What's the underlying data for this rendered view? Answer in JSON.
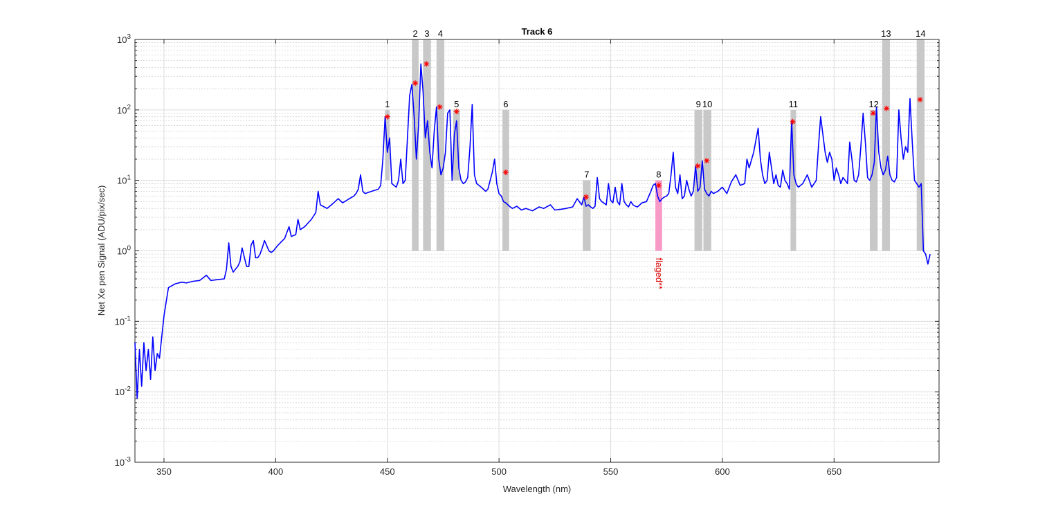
{
  "chart_data": {
    "type": "line",
    "title": "Track 6",
    "xlabel": "Wavelength (nm)",
    "ylabel": "Net Xe pen Signal (ADU/pix/sec)",
    "xlim": [
      337,
      697
    ],
    "ylim": [
      0.001,
      1000
    ],
    "yscale": "log",
    "grid": true,
    "x_ticks": [
      350,
      400,
      450,
      500,
      550,
      600,
      650
    ],
    "y_tick_exponents": [
      -3,
      -2,
      -1,
      0,
      1,
      2,
      3
    ],
    "y_tick_base": "10",
    "colors": {
      "line": "#0000ff",
      "marker": "#ff0000",
      "band": "#c8c8c8",
      "flag_band": "#f79ac8",
      "flag_text": "#dd0000"
    },
    "series": [
      {
        "values_x": [
          337,
          338,
          339,
          340,
          341,
          342,
          343,
          344,
          345,
          346,
          347,
          348,
          349,
          350,
          352,
          355,
          358,
          360,
          363,
          366,
          369,
          371,
          374,
          377,
          378,
          379,
          380,
          381,
          382,
          383,
          384,
          385,
          386,
          387,
          388,
          389,
          390,
          391,
          392,
          393,
          394,
          395,
          397,
          398,
          399,
          401,
          404,
          406,
          407,
          409,
          410,
          411,
          413,
          416,
          418,
          419,
          420,
          423,
          426,
          428,
          430,
          433,
          435,
          436,
          437,
          438,
          439,
          440,
          443,
          446,
          447,
          448,
          449,
          450,
          451,
          452,
          453,
          454,
          455,
          456,
          457,
          458,
          459,
          460,
          461,
          462,
          463,
          464,
          465,
          466,
          467,
          468,
          469,
          470,
          471,
          472,
          473,
          474,
          475,
          476,
          477,
          478,
          479,
          480,
          481,
          482,
          483,
          484,
          485,
          486,
          487,
          488,
          489,
          490,
          491,
          492,
          493,
          494,
          495,
          497,
          498,
          499,
          500,
          501,
          502,
          503,
          504,
          505,
          506,
          508,
          510,
          512,
          515,
          518,
          520,
          523,
          525,
          528,
          530,
          533,
          535,
          537,
          538,
          539,
          540,
          541,
          542,
          543,
          544,
          545,
          546,
          548,
          549,
          550,
          551,
          552,
          553,
          554,
          555,
          556,
          557,
          558,
          559,
          560,
          561,
          562,
          564,
          566,
          568,
          569,
          570,
          571,
          572,
          573,
          574,
          575,
          576,
          577,
          578,
          579,
          580,
          581,
          582,
          583,
          584,
          585,
          586,
          587,
          588,
          589,
          590,
          591,
          592,
          593,
          594,
          595,
          596,
          598,
          600,
          602,
          604,
          606,
          608,
          610,
          611,
          612,
          614,
          616,
          617,
          618,
          619,
          620,
          621,
          622,
          623,
          624,
          625,
          626,
          627,
          628,
          629,
          630,
          631,
          632,
          633,
          634,
          636,
          638,
          640,
          642,
          643,
          644,
          646,
          647,
          648,
          649,
          650,
          651,
          652,
          653,
          654,
          655,
          656,
          657,
          658,
          659,
          660,
          661,
          662,
          663,
          664,
          665,
          666,
          667,
          668,
          669,
          670,
          671,
          672,
          673,
          674,
          675,
          676,
          677,
          678,
          679,
          680,
          681,
          682,
          683,
          684,
          685,
          686,
          687,
          688,
          689,
          690,
          691,
          692,
          693,
          694,
          695,
          696,
          697
        ],
        "values_y": [
          0.05,
          0.008,
          0.04,
          0.012,
          0.05,
          0.02,
          0.04,
          0.015,
          0.06,
          0.02,
          0.035,
          0.03,
          0.06,
          0.12,
          0.3,
          0.34,
          0.36,
          0.35,
          0.37,
          0.38,
          0.45,
          0.38,
          0.39,
          0.4,
          0.55,
          1.3,
          0.6,
          0.5,
          0.55,
          0.6,
          0.7,
          1.1,
          0.8,
          0.6,
          0.6,
          1.2,
          1.4,
          0.8,
          0.8,
          0.9,
          1.1,
          1.4,
          1.0,
          0.95,
          1.0,
          1.2,
          1.5,
          2.2,
          1.6,
          1.7,
          2.8,
          2.0,
          2.2,
          2.8,
          3.5,
          7.0,
          4.5,
          4.0,
          4.8,
          5.5,
          4.8,
          5.5,
          6.0,
          6.5,
          7.5,
          12.0,
          7.0,
          6.5,
          7.0,
          7.5,
          8.5,
          20,
          80,
          25,
          40,
          9.0,
          8.5,
          8.0,
          10.0,
          20.0,
          9.0,
          10.0,
          40.0,
          160,
          230,
          80,
          20,
          60,
          450,
          180,
          40,
          70,
          25,
          15,
          50,
          110,
          20,
          12,
          15,
          25,
          90,
          100,
          10,
          45,
          70,
          15,
          10,
          9.0,
          9.5,
          11,
          30,
          120,
          12,
          9.0,
          8.5,
          8.0,
          7.5,
          7.0,
          7.5,
          13,
          20,
          9.0,
          6.5,
          6.0,
          5.0,
          4.8,
          4.5,
          4.2,
          4.0,
          4.3,
          3.8,
          4.0,
          3.7,
          4.2,
          4.0,
          4.5,
          3.8,
          3.9,
          4.0,
          4.2,
          5.5,
          4.5,
          5.8,
          4.3,
          4.5,
          4.2,
          4.0,
          4.3,
          11,
          5.5,
          5.0,
          4.5,
          9.0,
          5.2,
          4.8,
          8.0,
          5.0,
          4.5,
          9.0,
          5.0,
          4.5,
          4.2,
          5.0,
          4.5,
          4.3,
          4.2,
          4.8,
          5.0,
          7.0,
          8.5,
          9.0,
          6.0,
          5.0,
          5.5,
          5.8,
          6.0,
          6.5,
          12,
          25,
          8.0,
          6.5,
          12,
          5.5,
          6.0,
          10,
          7.5,
          6.0,
          7.0,
          16,
          7.0,
          8.0,
          19,
          7.5,
          6.5,
          6.0,
          7.0,
          6.5,
          7.0,
          8.0,
          6.5,
          9.5,
          12,
          8.5,
          9.0,
          20,
          15,
          25,
          55,
          20,
          12,
          9.0,
          10,
          25,
          15,
          9.0,
          12,
          8.5,
          8.0,
          14,
          10,
          9.0,
          7.5,
          70,
          12,
          9.0,
          8.0,
          9.0,
          12,
          8.0,
          10,
          30,
          80,
          25,
          18,
          25,
          20,
          10,
          15,
          12,
          9.0,
          11,
          10,
          9.0,
          35,
          20,
          10,
          9.5,
          12,
          30,
          90,
          35,
          11,
          10,
          12,
          18,
          110,
          25,
          15,
          12,
          14,
          22,
          12,
          10,
          9.5,
          11,
          100,
          40,
          20,
          30,
          25,
          145,
          35,
          10,
          9.0,
          8.0,
          9.0,
          1.0,
          0.9,
          0.65,
          0.9
        ],
        "peaks": [
          {
            "label": "1",
            "x": 450,
            "y": 80
          },
          {
            "label": "2",
            "x": 462.5,
            "y": 240
          },
          {
            "label": "3",
            "x": 467.5,
            "y": 450
          },
          {
            "label": "4",
            "x": 473.5,
            "y": 110
          },
          {
            "label": "5",
            "x": 481,
            "y": 95
          },
          {
            "label": "6",
            "x": 503,
            "y": 13
          },
          {
            "label": "7",
            "x": 539,
            "y": 5.8
          },
          {
            "label": "8",
            "x": 571.5,
            "y": 8.5
          },
          {
            "label": "9",
            "x": 589,
            "y": 16
          },
          {
            "label": "10",
            "x": 593,
            "y": 19
          },
          {
            "label": "11",
            "x": 631.5,
            "y": 68
          },
          {
            "label": "12",
            "x": 667.5,
            "y": 90
          },
          {
            "label": "13",
            "x": 673.5,
            "y": 105
          },
          {
            "label": "14",
            "x": 688.5,
            "y": 140
          }
        ]
      }
    ],
    "bands": [
      {
        "label": "1",
        "x_from": 449,
        "x_to": 451,
        "y_from": 10,
        "y_to": 100,
        "label_y": 100,
        "flagged": false
      },
      {
        "label": "2",
        "x_from": 461,
        "x_to": 464,
        "y_from": 1,
        "y_to": 1000,
        "label_y": 1000,
        "flagged": false
      },
      {
        "label": "3",
        "x_from": 466,
        "x_to": 469.5,
        "y_from": 1,
        "y_to": 1000,
        "label_y": 1000,
        "flagged": false
      },
      {
        "label": "4",
        "x_from": 472,
        "x_to": 475.5,
        "y_from": 1,
        "y_to": 1000,
        "label_y": 1000,
        "flagged": false
      },
      {
        "label": "5",
        "x_from": 479.5,
        "x_to": 482.5,
        "y_from": 10,
        "y_to": 100,
        "label_y": 100,
        "flagged": false
      },
      {
        "label": "6",
        "x_from": 501.5,
        "x_to": 504.5,
        "y_from": 1,
        "y_to": 100,
        "label_y": 100,
        "flagged": false
      },
      {
        "label": "7",
        "x_from": 537.5,
        "x_to": 541,
        "y_from": 1,
        "y_to": 10,
        "label_y": 10,
        "flagged": false
      },
      {
        "label": "8",
        "x_from": 570,
        "x_to": 573,
        "y_from": 1,
        "y_to": 10,
        "label_y": 10,
        "flagged": true
      },
      {
        "label": "9",
        "x_from": 587.5,
        "x_to": 591,
        "y_from": 1,
        "y_to": 100,
        "label_y": 100,
        "flagged": false
      },
      {
        "label": "10",
        "x_from": 591.5,
        "x_to": 595,
        "y_from": 1,
        "y_to": 100,
        "label_y": 100,
        "flagged": false
      },
      {
        "label": "11",
        "x_from": 630.5,
        "x_to": 633,
        "y_from": 1,
        "y_to": 100,
        "label_y": 100,
        "flagged": false
      },
      {
        "label": "12",
        "x_from": 666,
        "x_to": 669.5,
        "y_from": 1,
        "y_to": 100,
        "label_y": 100,
        "flagged": false
      },
      {
        "label": "13",
        "x_from": 671.5,
        "x_to": 675,
        "y_from": 1,
        "y_to": 1000,
        "label_y": 1000,
        "flagged": false
      },
      {
        "label": "14",
        "x_from": 687,
        "x_to": 690.5,
        "y_from": 1,
        "y_to": 1000,
        "label_y": 1000,
        "flagged": false
      }
    ],
    "flag_annotation": {
      "text": "flaged**",
      "x": 571.5
    }
  }
}
